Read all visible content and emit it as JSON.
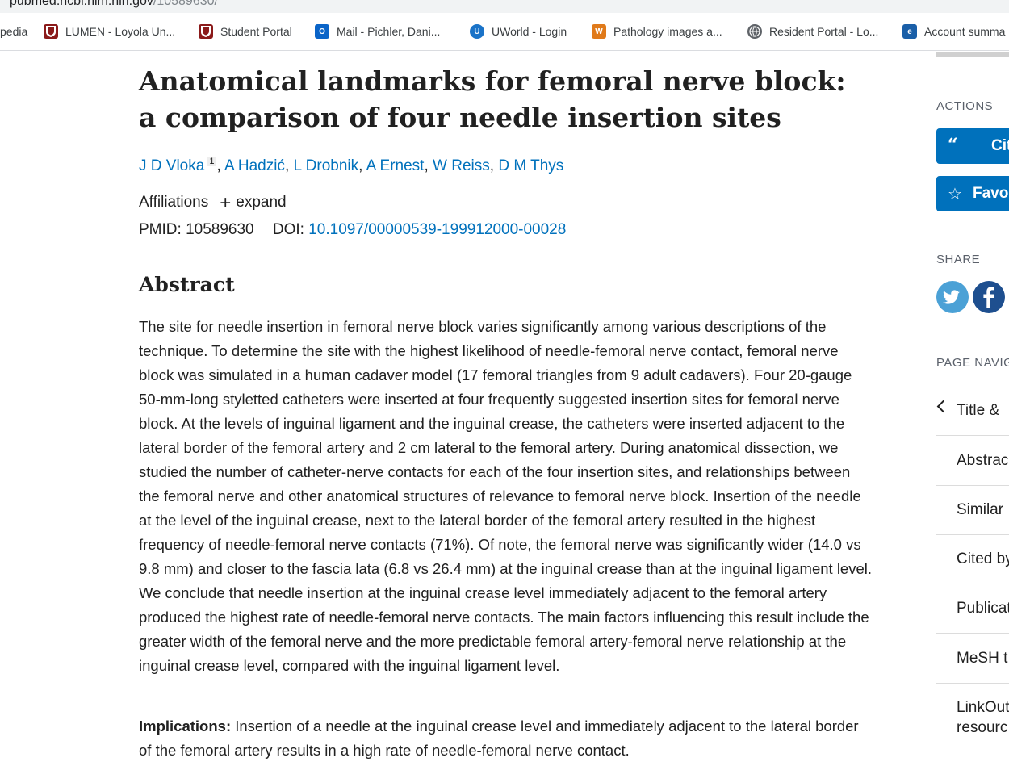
{
  "browser": {
    "url_host": "pubmed.ncbi.nlm.nih.gov",
    "url_path": "/10589630/",
    "bookmarks": [
      {
        "label": "pedia",
        "icon": "none",
        "color": ""
      },
      {
        "label": "LUMEN - Loyola Un...",
        "icon": "loyola-shield-icon",
        "color": "#8b1a1a"
      },
      {
        "label": "Student Portal",
        "icon": "loyola-shield-icon",
        "color": "#8b1a1a"
      },
      {
        "label": "Mail - Pichler, Dani...",
        "icon": "outlook-icon",
        "color": "#0a64c8"
      },
      {
        "label": "UWorld - Login",
        "icon": "uworld-icon",
        "color": "#1a73c8"
      },
      {
        "label": "Pathology images a...",
        "icon": "pathology-icon",
        "color": "#e07a1a"
      },
      {
        "label": "Resident Portal - Lo...",
        "icon": "globe-icon",
        "color": "#5f6368"
      },
      {
        "label": "Account summa",
        "icon": "account-icon",
        "color": "#1a5fa8"
      }
    ]
  },
  "article": {
    "title": "Anatomical landmarks for femoral nerve block: a comparison of four needle insertion sites",
    "authors": [
      "J D Vloka",
      "A Hadzić",
      "L Drobnik",
      "A Ernest",
      "W Reiss",
      "D M Thys"
    ],
    "first_author_affiliation_ref": "1",
    "affiliations_label": "Affiliations",
    "expand_label": "expand",
    "pmid_label": "PMID:",
    "pmid": "10589630",
    "doi_label": "DOI:",
    "doi": "10.1097/00000539-199912000-00028",
    "abstract_heading": "Abstract",
    "abstract_text": "The site for needle insertion in femoral nerve block varies significantly among various descriptions of the technique. To determine the site with the highest likelihood of needle-femoral nerve contact, femoral nerve block was simulated in a human cadaver model (17 femoral triangles from 9 adult cadavers). Four 20-gauge 50-mm-long styletted catheters were inserted at four frequently suggested insertion sites for femoral nerve block. At the levels of inguinal ligament and the inguinal crease, the catheters were inserted adjacent to the lateral border of the femoral artery and 2 cm lateral to the femoral artery. During anatomical dissection, we studied the number of catheter-nerve contacts for each of the four insertion sites, and relationships between the femoral nerve and other anatomical structures of relevance to femoral nerve block. Insertion of the needle at the level of the inguinal crease, next to the lateral border of the femoral artery resulted in the highest frequency of needle-femoral nerve contacts (71%). Of note, the femoral nerve was significantly wider (14.0 vs 9.8 mm) and closer to the fascia lata (6.8 vs 26.4 mm) at the inguinal crease than at the inguinal ligament level. We conclude that needle insertion at the inguinal crease level immediately adjacent to the femoral artery produced the highest rate of needle-femoral nerve contacts. The main factors influencing this result include the greater width of the femoral nerve and the more predictable femoral artery-femoral nerve relationship at the inguinal crease level, compared with the inguinal ligament level.",
    "implications_label": "Implications:",
    "implications_text": "Insertion of a needle at the inguinal crease level and immediately adjacent to the lateral border of the femoral artery results in a high rate of needle-femoral nerve contact."
  },
  "sidebar": {
    "actions_label": "ACTIONS",
    "cite_label": "Cit",
    "cite_icon": "quote-icon",
    "favorites_label": "Favo",
    "favorites_icon": "star-icon",
    "share_label": "SHARE",
    "share_icons": [
      "twitter-icon",
      "facebook-icon"
    ],
    "twitter_color": "#4ba1d6",
    "facebook_color": "#1e4f8f",
    "page_nav_label": "PAGE NAVIG",
    "nav_items": [
      "Title & ",
      "Abstrac",
      "Similar ",
      "Cited by",
      "Publicat",
      "MeSH t",
      "LinkOut",
      "resourc"
    ]
  },
  "colors": {
    "link": "#0071bc",
    "button": "#0071bc",
    "text": "#212121"
  }
}
